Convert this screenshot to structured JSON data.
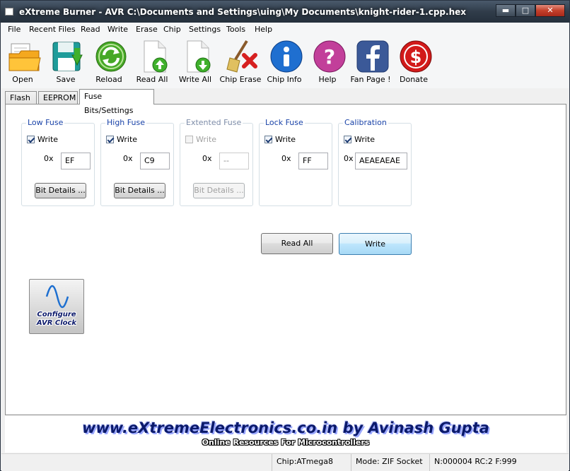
{
  "window": {
    "title": "eXtreme Burner - AVR C:\\Documents and Settings\\uing\\My Documents\\knight-rider-1.cpp.hex"
  },
  "menu": [
    "File",
    "Recent Files",
    "Read",
    "Write",
    "Erase",
    "Chip",
    "Settings",
    "Tools",
    "Help"
  ],
  "toolbar": {
    "open": "Open",
    "save": "Save",
    "reload": "Reload",
    "read_all": "Read All",
    "write_all": "Write All",
    "chip_erase": "Chip Erase",
    "chip_info": "Chip Info",
    "help": "Help",
    "fan_page": "Fan Page !",
    "donate": "Donate"
  },
  "tabs": [
    "Flash",
    "EEPROM",
    "Fuse Bits/Settings"
  ],
  "fuses": [
    {
      "title": "Low Fuse",
      "write_label": "Write",
      "prefix": "0x",
      "value": "EF",
      "button": "Bit Details ..."
    },
    {
      "title": "High Fuse",
      "write_label": "Write",
      "prefix": "0x",
      "value": "C9",
      "button": "Bit Details ..."
    },
    {
      "title": "Extented Fuse",
      "write_label": "Write",
      "prefix": "0x",
      "value": "--",
      "button": "Bit Details ..."
    },
    {
      "title": "Lock Fuse",
      "write_label": "Write",
      "prefix": "0x",
      "value": "FF"
    },
    {
      "title": "Calibration",
      "write_label": "Write",
      "prefix": "0x",
      "value": "AEAEAEAE"
    }
  ],
  "actions": {
    "read_all": "Read All",
    "write": "Write"
  },
  "clock_button": {
    "line1": "Configure",
    "line2": "AVR Clock"
  },
  "banner": {
    "main": "www.eXtremeElectronics.co.in by Avinash Gupta",
    "sub": "Online Resources For Microcontrollers"
  },
  "status": {
    "chip": "Chip:ATmega8",
    "mode": "Mode: ZIF Socket",
    "counters": "N:000004 RC:2 F:999"
  },
  "colors": {
    "group_title": "#1a43a8",
    "banner_text": "#0b1a6b",
    "write_button": "#bee6fd"
  }
}
